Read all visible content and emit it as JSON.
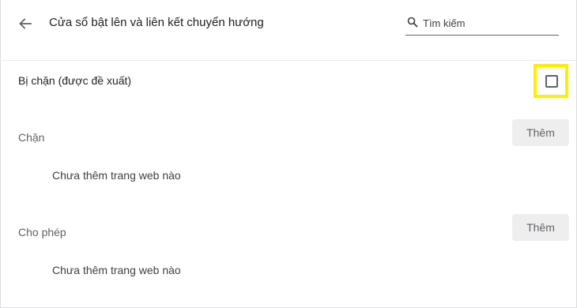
{
  "header": {
    "title": "Cửa sổ bật lên và liên kết chuyển hướng",
    "search_placeholder": "Tìm kiếm",
    "back_icon": "arrow-back-icon",
    "search_icon": "search-icon"
  },
  "blocked_setting": {
    "label": "Bị chặn (được đề xuất)",
    "checked": false,
    "highlight_color": "#ffee00"
  },
  "block_section": {
    "title": "Chặn",
    "add_label": "Thêm",
    "empty_text": "Chưa thêm trang web nào"
  },
  "allow_section": {
    "title": "Cho phép",
    "add_label": "Thêm",
    "empty_text": "Chưa thêm trang web nào"
  }
}
